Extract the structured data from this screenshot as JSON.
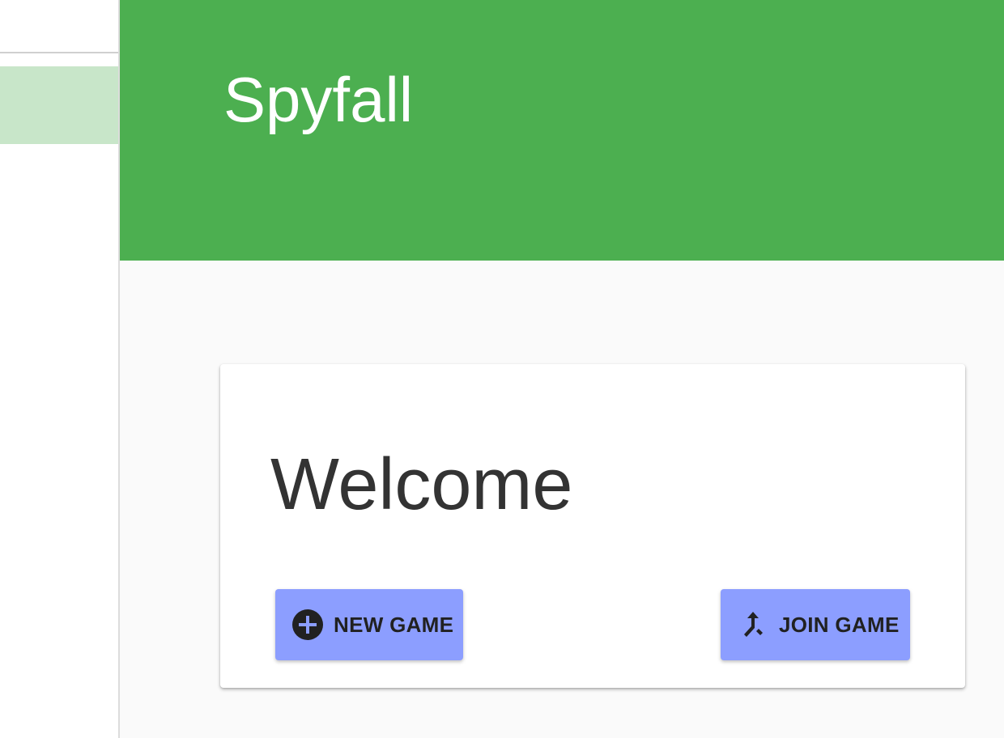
{
  "app": {
    "title": "Spyfall"
  },
  "colors": {
    "appbar": "#4caf50",
    "sidebar_active": "#c8e6c9",
    "button": "#8c9eff",
    "background": "#fafafa"
  },
  "sidebar": {
    "items": [
      {
        "label": "",
        "active": true
      }
    ]
  },
  "main": {
    "heading": "Welcome",
    "buttons": {
      "new_game": {
        "label": "NEW GAME",
        "icon": "add-circle-icon"
      },
      "join_game": {
        "label": "JOIN GAME",
        "icon": "merge-icon"
      }
    }
  }
}
